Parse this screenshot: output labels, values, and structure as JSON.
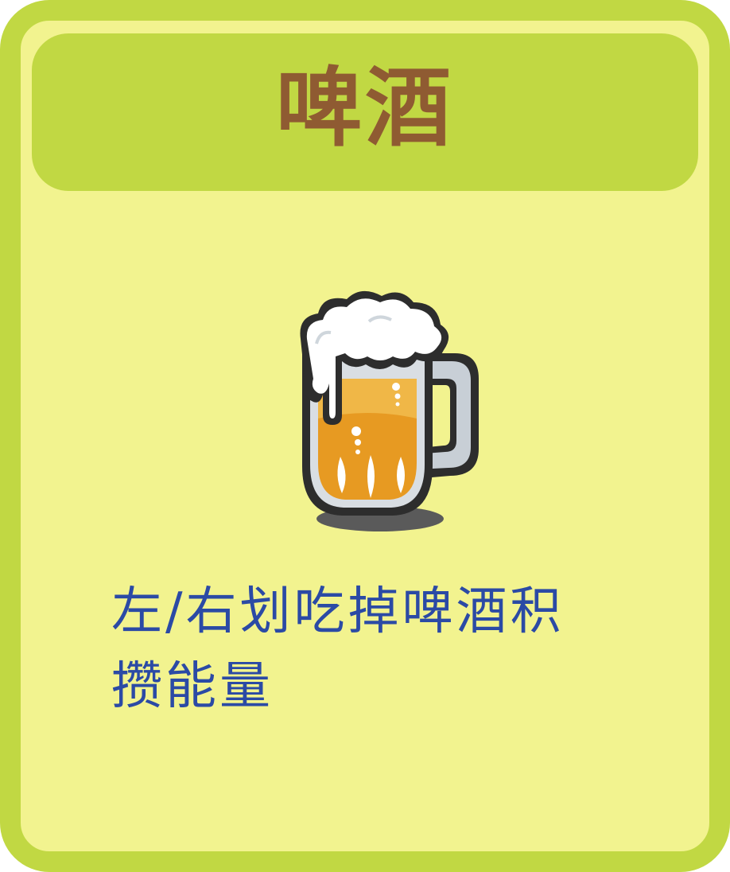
{
  "card": {
    "title": "啤酒",
    "description_line1": "左/右划吃掉啤酒积",
    "description_line2": "攒能量",
    "icon": "beer-mug-icon"
  },
  "colors": {
    "card_border": "#c1d843",
    "card_background": "#f2f38f",
    "title": "#8f5b32",
    "description": "#2b4aa5"
  }
}
